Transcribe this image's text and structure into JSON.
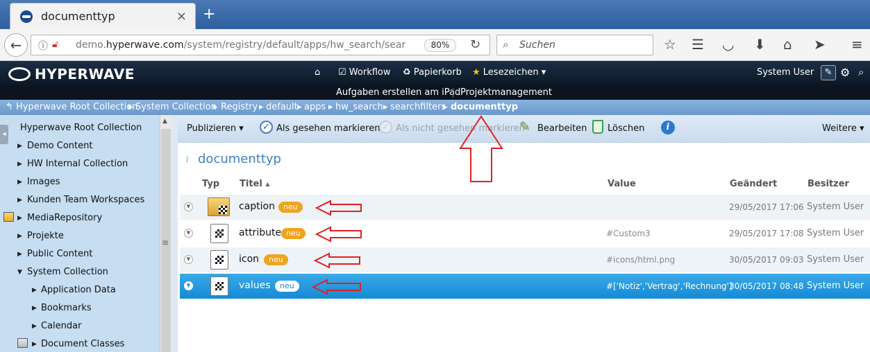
{
  "browser": {
    "tab_title": "documenttyp",
    "tab_close": "×",
    "new_tab": "+",
    "url_prefix": "demo.",
    "url_domain": "hyperwave.com",
    "url_path": "/system/registry/default/apps/hw_search/searchfil",
    "zoom": "80%",
    "search_placeholder": "Suchen"
  },
  "hw": {
    "logo": "HYPERWAVE",
    "menu": {
      "workflow": "Workflow",
      "trash": "Papierkorb",
      "bookmarks": "Lesezeichen ▾"
    },
    "user": "System User",
    "sub_menu": [
      "Aufgaben erstellen am iPad",
      "Projektmanagement"
    ]
  },
  "breadcrumb": {
    "items": [
      "Hyperwave Root Collection",
      "System Collection",
      "Registry",
      "default",
      "apps",
      "hw_search",
      "searchfilters"
    ],
    "current": "documenttyp"
  },
  "sidebar": {
    "root": "Hyperwave Root Collection",
    "items": [
      "Demo Content",
      "HW Internal Collection",
      "Images",
      "Kunden Team Workspaces",
      "MediaRepository",
      "Projekte",
      "Public Content",
      "System Collection",
      "Application Data",
      "Bookmarks",
      "Calendar",
      "Document Classes"
    ]
  },
  "toolbar": {
    "publish": "Publizieren ▾",
    "mark_seen": "Als gesehen markieren",
    "mark_unseen": "Als nicht gesehen markieren",
    "edit": "Bearbeiten",
    "delete": "Löschen",
    "more": "Weitere ▾"
  },
  "page": {
    "title": "documenttyp",
    "columns": {
      "type": "Typ",
      "title": "Titel",
      "value": "Value",
      "changed": "Geändert",
      "owner": "Besitzer"
    },
    "rows": [
      {
        "name": "caption",
        "badge": "neu",
        "value": "",
        "changed": "29/05/2017 17:06",
        "owner": "System User"
      },
      {
        "name": "attribute",
        "badge": "neu",
        "value": "#Custom3",
        "changed": "29/05/2017 17:08",
        "owner": "System User"
      },
      {
        "name": "icon",
        "badge": "neu",
        "value": "#icons/html.png",
        "changed": "30/05/2017 09:03",
        "owner": "System User"
      },
      {
        "name": "values",
        "badge": "neu",
        "value": "#['Notiz','Vertrag','Rechnung']",
        "changed": "30/05/2017 08:48",
        "owner": "System User"
      }
    ]
  },
  "colors": {
    "hw_header": "#0b1726",
    "breadcrumb": "#7aa6d6",
    "sidebar": "#c6ddf2",
    "selected_row": "#148ad6",
    "badge": "#f0a41e",
    "annotation": "#e02020"
  }
}
